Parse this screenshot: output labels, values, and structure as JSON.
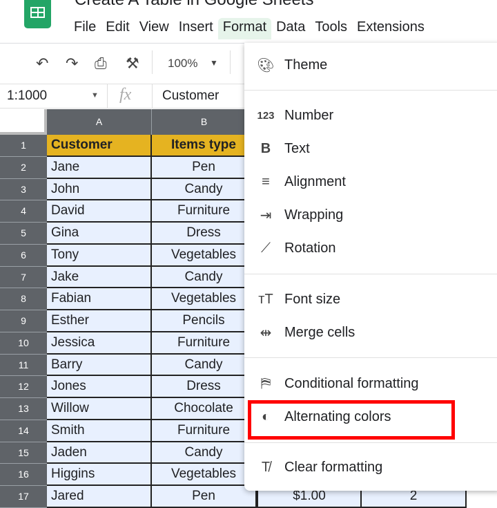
{
  "app": {
    "title": "Create A Table in Google Sheets"
  },
  "menubar": [
    "File",
    "Edit",
    "View",
    "Insert",
    "Format",
    "Data",
    "Tools",
    "Extensions"
  ],
  "toolbar": {
    "zoom": "100%"
  },
  "formula_bar": {
    "name_box": "1:1000",
    "fx": "fx",
    "value": "Customer"
  },
  "columns": [
    "A",
    "B"
  ],
  "rows": [
    {
      "n": "1",
      "a": "Customer",
      "b": "Items type"
    },
    {
      "n": "2",
      "a": "Jane",
      "b": "Pen"
    },
    {
      "n": "3",
      "a": "John",
      "b": "Candy"
    },
    {
      "n": "4",
      "a": "David",
      "b": "Furniture"
    },
    {
      "n": "5",
      "a": "Gina",
      "b": "Dress"
    },
    {
      "n": "6",
      "a": "Tony",
      "b": "Vegetables"
    },
    {
      "n": "7",
      "a": "Jake",
      "b": "Candy"
    },
    {
      "n": "8",
      "a": "Fabian",
      "b": "Vegetables"
    },
    {
      "n": "9",
      "a": "Esther",
      "b": "Pencils"
    },
    {
      "n": "10",
      "a": "Jessica",
      "b": "Furniture"
    },
    {
      "n": "11",
      "a": "Barry",
      "b": "Candy"
    },
    {
      "n": "12",
      "a": "Jones",
      "b": "Dress"
    },
    {
      "n": "13",
      "a": "Willow",
      "b": "Chocolate"
    },
    {
      "n": "14",
      "a": "Smith",
      "b": "Furniture"
    },
    {
      "n": "15",
      "a": "Jaden",
      "b": "Candy"
    },
    {
      "n": "16",
      "a": "Higgins",
      "b": "Vegetables"
    },
    {
      "n": "17",
      "a": "Jared",
      "b": "Pen",
      "c": "$1.00",
      "d": "2"
    }
  ],
  "format_menu": {
    "items": [
      {
        "label": "Theme",
        "icon": "palette-icon"
      },
      {
        "label": "Number",
        "icon": "number-icon"
      },
      {
        "label": "Text",
        "icon": "bold-icon"
      },
      {
        "label": "Alignment",
        "icon": "align-icon"
      },
      {
        "label": "Wrapping",
        "icon": "wrap-icon"
      },
      {
        "label": "Rotation",
        "icon": "rotation-icon"
      },
      {
        "label": "Font size",
        "icon": "font-size-icon"
      },
      {
        "label": "Merge cells",
        "icon": "merge-icon"
      },
      {
        "label": "Conditional formatting",
        "icon": "paint-roller-icon"
      },
      {
        "label": "Alternating colors",
        "icon": "fill-drop-icon",
        "highlighted": true
      },
      {
        "label": "Clear formatting",
        "icon": "clear-format-icon"
      }
    ]
  },
  "colors": {
    "header_fill": "#e5b321",
    "cell_fill": "#e8f0fe",
    "highlight": "#ff0000",
    "logo": "#23a566"
  }
}
